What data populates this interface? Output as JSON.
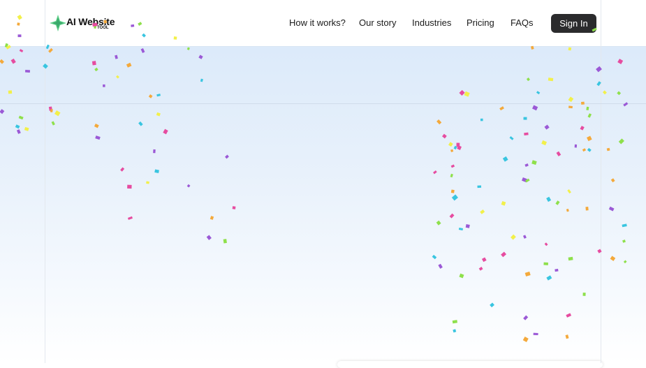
{
  "brand": {
    "logo_text": "AI Website",
    "logo_sub": "TOOL",
    "logo_icon": "sparkle-icon",
    "logo_color": "#5fd08a"
  },
  "nav": {
    "items": [
      "How it works?",
      "Our story",
      "Industries",
      "Pricing",
      "FAQs"
    ]
  },
  "header": {
    "signin_label": "Sign In"
  },
  "colors": {
    "hero_top": "#dceafa",
    "signin_bg": "#2b2b2d",
    "confetti": [
      "#f4a93b",
      "#39c5e0",
      "#9b59d6",
      "#e64ca0",
      "#8ee04b",
      "#f2f04a"
    ]
  }
}
